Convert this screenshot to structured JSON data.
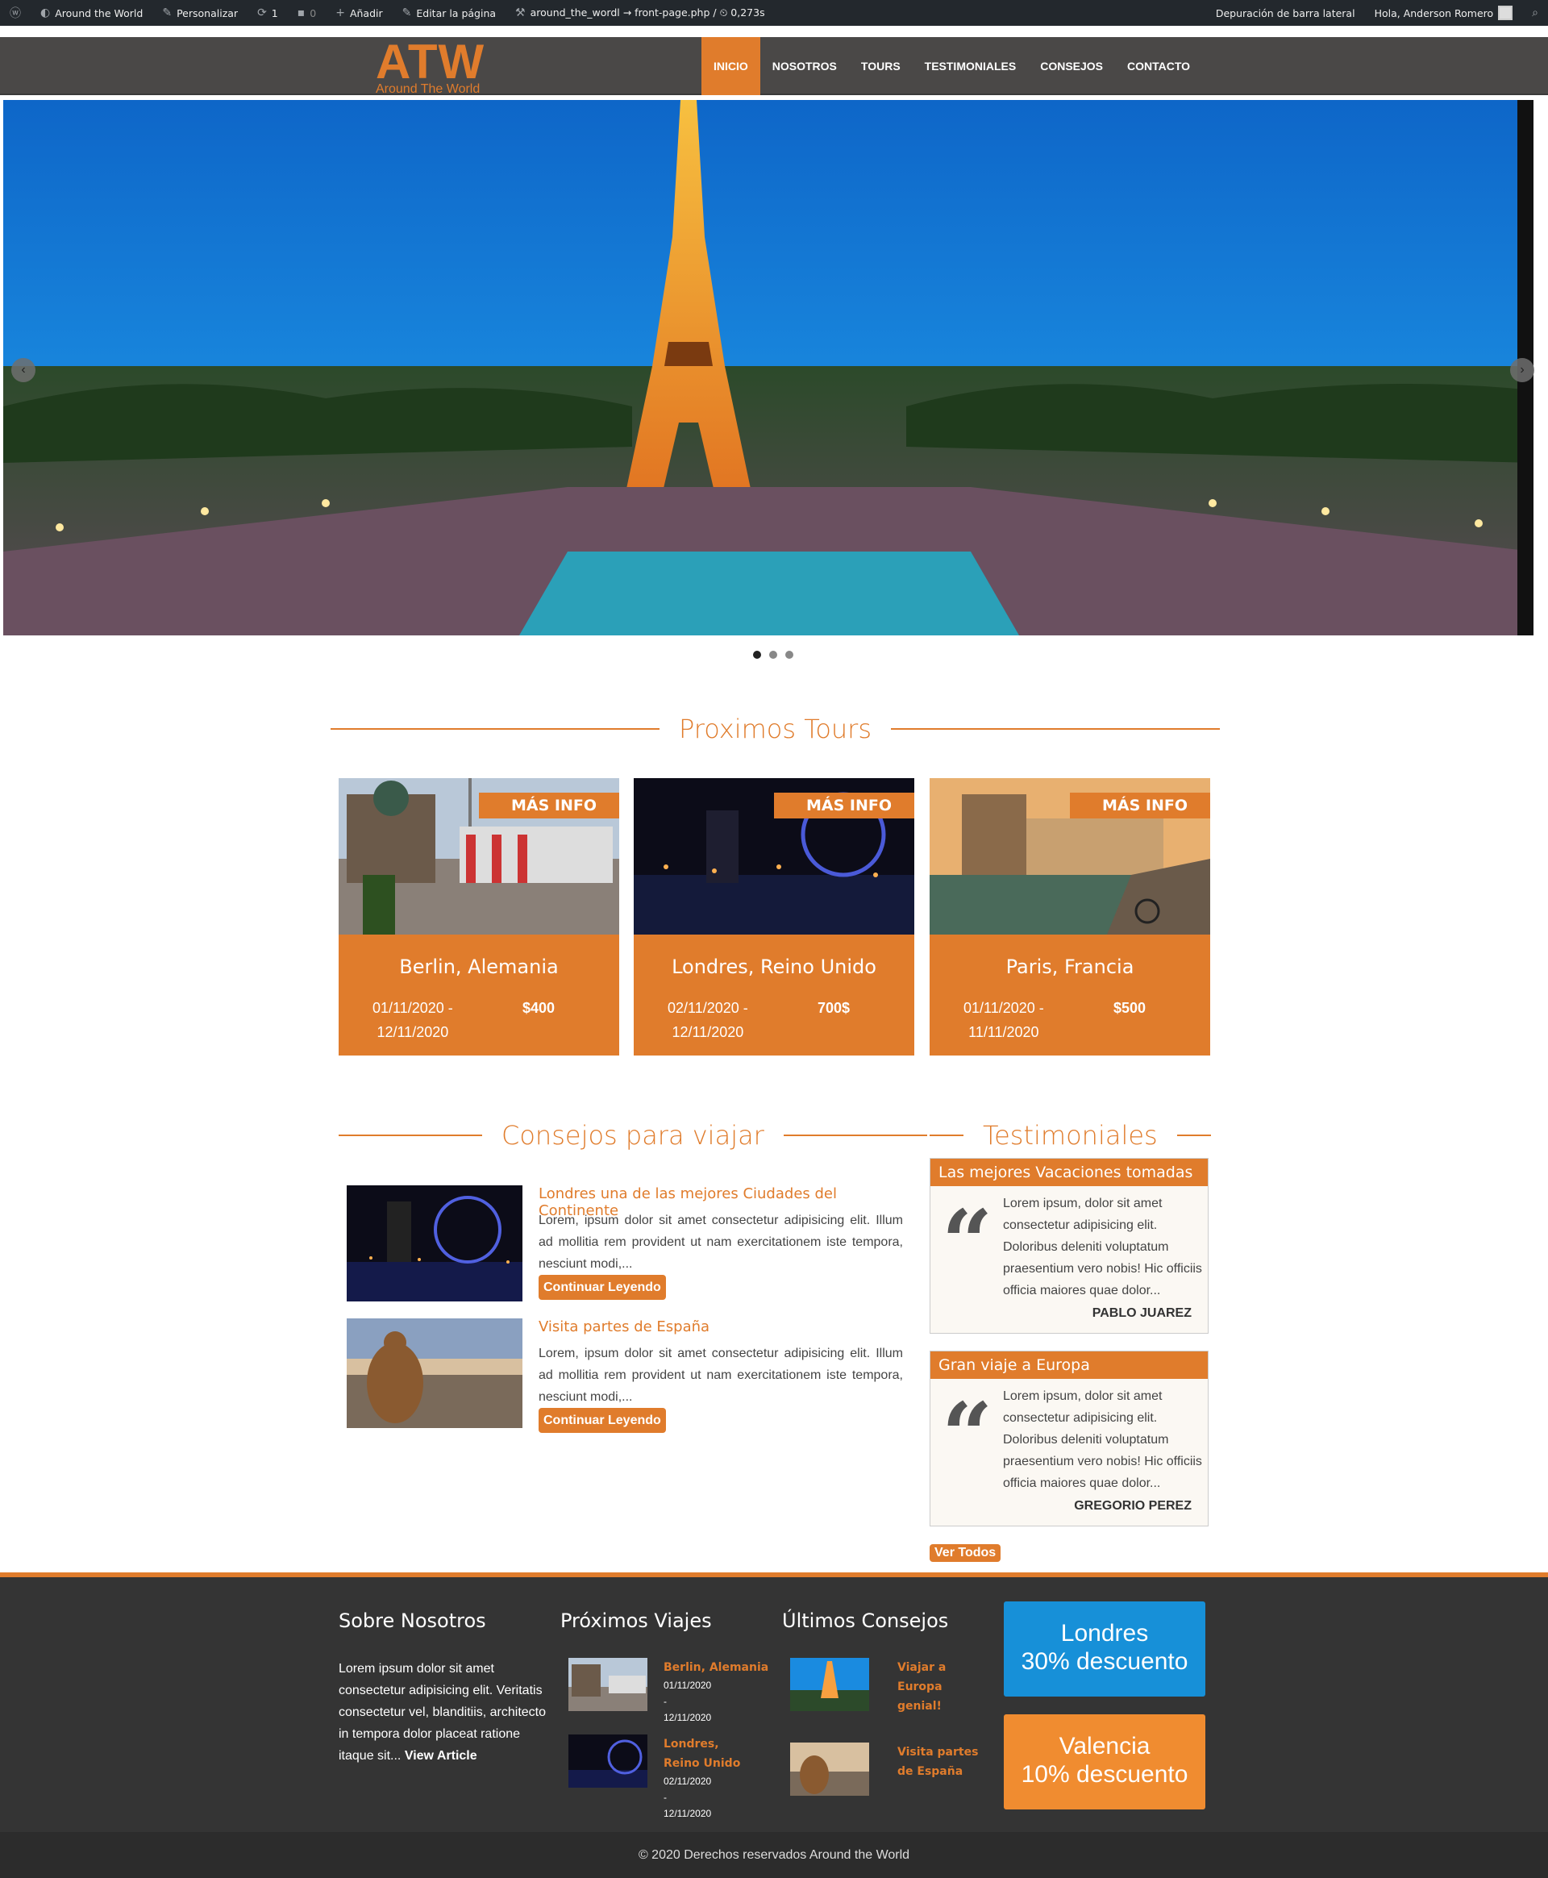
{
  "admin_bar": {
    "site": "Around the World",
    "customize": "Personalizar",
    "updates": "1",
    "comments": "0",
    "add": "Añadir",
    "edit": "Editar la página",
    "template": "around_the_wordl → front-page.php / ⏲ 0,273s",
    "debug": "Depuración de barra lateral",
    "greeting": "Hola, Anderson Romero"
  },
  "header": {
    "logo_big": "ATW",
    "logo_small": "Around The World",
    "nav": [
      "INICIO",
      "NOSOTROS",
      "TOURS",
      "TESTIMONIALES",
      "CONSEJOS",
      "CONTACTO"
    ],
    "active_color": "#e07c2c"
  },
  "slider": {
    "slides": 3,
    "active": 1
  },
  "tours": {
    "title": "Proximos Tours",
    "more": "MÁS INFO",
    "items": [
      {
        "name": "Berlin, Alemania",
        "date1": "01/11/2020 -",
        "date2": "12/11/2020",
        "price": "$400"
      },
      {
        "name": "Londres, Reino Unido",
        "date1": "02/11/2020 -",
        "date2": "12/11/2020",
        "price": "700$"
      },
      {
        "name": "Paris, Francia",
        "date1": "01/11/2020 -",
        "date2": "11/11/2020",
        "price": "$500"
      }
    ]
  },
  "tips": {
    "title": "Consejos para viajar",
    "button": "Continuar Leyendo",
    "posts": [
      {
        "title": "Londres una de las mejores Ciudades del Continente",
        "excerpt": "Lorem, ipsum dolor sit amet consectetur adipisicing elit. Illum ad mollitia rem provident ut nam exercitationem iste tempora, nesciunt modi,..."
      },
      {
        "title": "Visita partes de España",
        "excerpt": "Lorem, ipsum dolor sit amet consectetur adipisicing elit. Illum ad mollitia rem provident ut nam exercitationem iste tempora, nesciunt modi,..."
      }
    ]
  },
  "testimonials": {
    "title": "Testimoniales",
    "button": "Ver Todos",
    "items": [
      {
        "heading": "Las mejores Vacaciones tomadas",
        "text": "Lorem ipsum, dolor sit amet consectetur adipisicing elit. Doloribus deleniti voluptatum praesentium vero nobis! Hic officiis officia maiores quae dolor...",
        "author": "PABLO JUAREZ"
      },
      {
        "heading": "Gran viaje a Europa",
        "text": "Lorem ipsum, dolor sit amet consectetur adipisicing elit. Doloribus deleniti voluptatum praesentium vero nobis! Hic officiis officia maiores quae dolor...",
        "author": "GREGORIO PEREZ"
      }
    ]
  },
  "footer": {
    "about_title": "Sobre Nosotros",
    "about_text": "Lorem ipsum dolor sit amet consectetur adipisicing elit. Veritatis consectetur vel, blanditiis, architecto in tempora dolor placeat ratione itaque sit...",
    "about_link": "View Article",
    "trips_title": "Próximos Viajes",
    "trips": [
      {
        "name": "Berlin, Alemania",
        "d1": "01/11/2020",
        "sep": "-",
        "d2": "12/11/2020"
      },
      {
        "name": "Londres, Reino Unido",
        "d1": "02/11/2020",
        "sep": "-",
        "d2": "12/11/2020"
      }
    ],
    "tips_title": "Últimos Consejos",
    "tips": [
      "Viajar a Europa genial!",
      "Visita partes de España"
    ],
    "promos": [
      {
        "line1": "Londres",
        "line2": "30% descuento"
      },
      {
        "line1": "Valencia",
        "line2": "10% descuento"
      }
    ],
    "copyright": "© 2020 Derechos reservados Around the World"
  }
}
